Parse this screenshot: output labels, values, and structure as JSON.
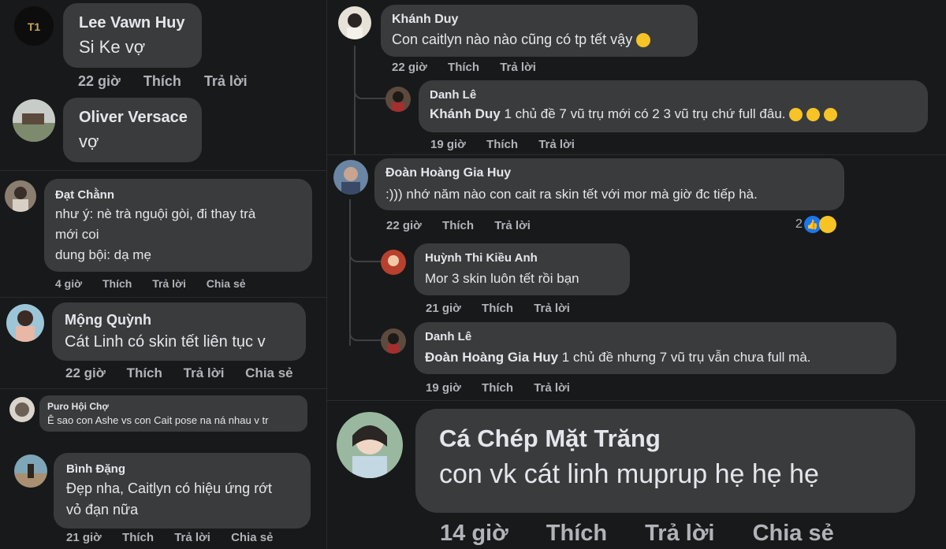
{
  "actions": {
    "like": "Thích",
    "reply": "Trả lời",
    "share": "Chia sẻ"
  },
  "c1": {
    "name": "Lee Vawn Huy",
    "text": "Si Ke vợ",
    "time": "22 giờ"
  },
  "c2": {
    "name": "Oliver Versace",
    "text": "vợ"
  },
  "c3": {
    "name": "Đạt Chằnn",
    "line1": "như ý: nè trà nguội gòi, đi thay trà",
    "line2": "mới coi",
    "line3": "dung bội: dạ mẹ",
    "time": "4 giờ"
  },
  "c4": {
    "name": "Mộng Quỳnh",
    "text": "Cát Linh có skin tết liên tục v",
    "time": "22 giờ"
  },
  "c5": {
    "name": "Puro Hội Chợ",
    "text": "Ê sao con Ashe vs con Cait pose na ná nhau v tr"
  },
  "c6": {
    "name": "Bình Đặng",
    "line1": "Đẹp nha, Caitlyn có hiệu ứng rớt",
    "line2": "vỏ đạn nữa",
    "time": "21 giờ"
  },
  "r1": {
    "name": "Khánh Duy",
    "text": "Con caitlyn nào nào cũng có tp tết vậy",
    "time": "22 giờ"
  },
  "r2": {
    "name": "Danh Lê",
    "tag": "Khánh Duy",
    "text": " 1 chủ đề 7 vũ trụ mới có 2 3 vũ trụ chứ full đâu.",
    "time": "19 giờ"
  },
  "r3": {
    "name": "Đoàn Hoàng Gia Huy",
    "text": ":))) nhớ năm nào con cait ra skin tết với mor mà giờ đc tiếp hà.",
    "time": "22 giờ",
    "reactions": "2"
  },
  "r4": {
    "name": "Huỳnh Thi Kiều Anh",
    "text": "Mor 3 skin luôn tết rồi bạn",
    "time": "21 giờ"
  },
  "r5": {
    "name": "Danh Lê",
    "tag": "Đoàn Hoàng Gia Huy",
    "text": " 1 chủ đề nhưng 7 vũ trụ vẫn chưa full mà.",
    "time": "19 giờ"
  },
  "r6": {
    "name": "Cá Chép Mặt Trăng",
    "text": "con vk cát linh muprup hẹ hẹ hẹ",
    "time": "14 giờ"
  },
  "colors": {
    "bg": "#18191a",
    "bubble": "#3a3b3c",
    "meta": "#b0b3b8",
    "like_blue": "#1877f2",
    "haha_yellow": "#f7c325"
  }
}
